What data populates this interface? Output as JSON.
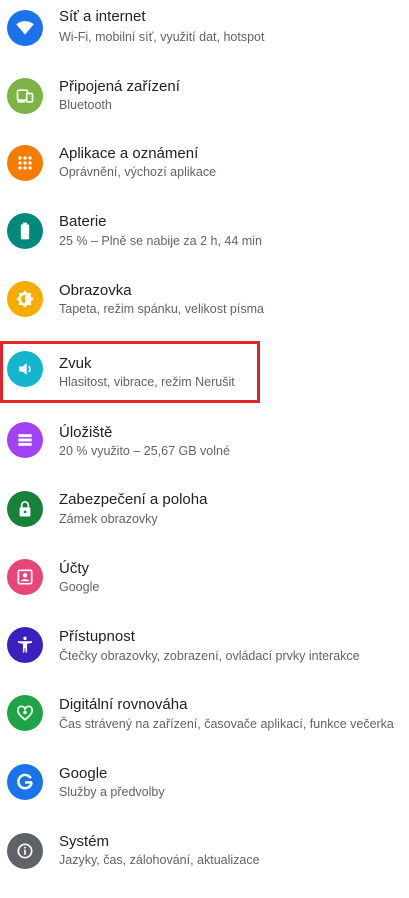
{
  "settings": {
    "items": [
      {
        "title": "Síť a internet",
        "subtitle": "Wi-Fi, mobilní síť, využití dat, hotspot",
        "icon": "wifi-icon",
        "color": "#1a73e8"
      },
      {
        "title": "Připojená zařízení",
        "subtitle": "Bluetooth",
        "icon": "devices-icon",
        "color": "#7cb342"
      },
      {
        "title": "Aplikace a oznámení",
        "subtitle": "Oprávnění, výchozí aplikace",
        "icon": "apps-grid-icon",
        "color": "#f57c00"
      },
      {
        "title": "Baterie",
        "subtitle": "25 % – Plně se nabije za 2 h, 44 min",
        "icon": "battery-icon",
        "color": "#00897b"
      },
      {
        "title": "Obrazovka",
        "subtitle": "Tapeta, režim spánku, velikost písma",
        "icon": "brightness-icon",
        "color": "#f9ab00"
      },
      {
        "title": "Zvuk",
        "subtitle": "Hlasitost, vibrace, režim Nerušit",
        "icon": "volume-icon",
        "color": "#12b5cb"
      },
      {
        "title": "Úložiště",
        "subtitle": "20 % využito – 25,67 GB volné",
        "icon": "storage-icon",
        "color": "#a142f4"
      },
      {
        "title": "Zabezpečení a poloha",
        "subtitle": "Zámek obrazovky",
        "icon": "lock-icon",
        "color": "#188038"
      },
      {
        "title": "Účty",
        "subtitle": "Google",
        "icon": "account-icon",
        "color": "#e8457a"
      },
      {
        "title": "Přístupnost",
        "subtitle": "Čtečky obrazovky, zobrazení, ovládací prvky interakce",
        "icon": "accessibility-icon",
        "color": "#3c1fbf"
      },
      {
        "title": "Digitální rovnováha",
        "subtitle": "Čas strávený na zařízení, časovače aplikací, funkce večerka",
        "icon": "wellbeing-icon",
        "color": "#1ea446"
      },
      {
        "title": "Google",
        "subtitle": "Služby a předvolby",
        "icon": "google-icon",
        "color": "#1a73e8"
      },
      {
        "title": "Systém",
        "subtitle": "Jazyky, čas, zálohování, aktualizace",
        "icon": "info-icon",
        "color": "#5f6368"
      }
    ],
    "highlight_color": "#e2232a"
  }
}
